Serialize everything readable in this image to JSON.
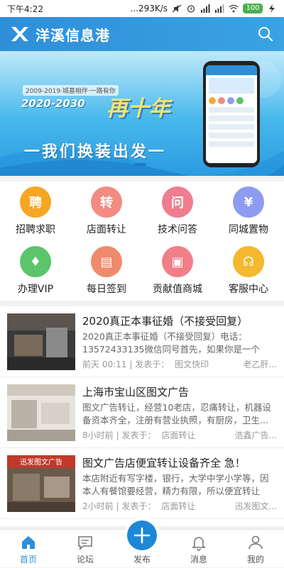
{
  "status": {
    "time": "下午4:22",
    "speed": "...293K/s",
    "battery": "100"
  },
  "header": {
    "title": "洋溪信息港",
    "logo": "X"
  },
  "banner": {
    "tag": "2009-2019·城基相伴·一路有你",
    "year_range": "2020-2030",
    "headline": "再十年",
    "subline": "一我们换装出发一"
  },
  "grid": {
    "items": [
      {
        "label": "招聘求职",
        "glyph": "聘",
        "color": "#f5a623",
        "icon": "recruit-icon"
      },
      {
        "label": "店面转让",
        "glyph": "转",
        "color": "#f28b82",
        "icon": "transfer-icon"
      },
      {
        "label": "技术问答",
        "glyph": "问",
        "color": "#ef7d8f",
        "icon": "qa-icon"
      },
      {
        "label": "同城置物",
        "glyph": "¥",
        "color": "#8d9cf0",
        "icon": "market-icon"
      },
      {
        "label": "办理VIP",
        "glyph": "♦",
        "color": "#5cc46a",
        "icon": "vip-icon"
      },
      {
        "label": "每日签到",
        "glyph": "▤",
        "color": "#f08a6c",
        "icon": "checkin-icon"
      },
      {
        "label": "贡献值商城",
        "glyph": "▣",
        "color": "#f07f8a",
        "icon": "shop-icon"
      },
      {
        "label": "客服中心",
        "glyph": "☊",
        "color": "#f5b82e",
        "icon": "service-icon"
      }
    ]
  },
  "news": [
    {
      "title": "2020真正本事征婚（不接受回复）",
      "desc": "2020真正本事征婚（不接受回复）电话：13572433135微信同号首先，如果你是一个浮...",
      "time": "前天 00:11",
      "posted_in": "发表于：",
      "board": "图文快印",
      "author": "老乙肝..."
    },
    {
      "title": "上海市宝山区图文广告",
      "desc": "图文广告转让，经营10老店，忍痛转让，机器设备资本齐全，注册有营业执照，有厨房，卫生...",
      "time": "8小时前",
      "posted_in": "发表于：",
      "board": "店面转让",
      "author": "浩鑫广告..."
    },
    {
      "title": "图文广告店便宜转让设备齐全 急！",
      "desc": "本店附近有写字楼，银行，大学中学小学等，因本人有餐馆要经营，精力有限，所以便宜转让",
      "time": "2小时前",
      "posted_in": "发表于：",
      "board": "店面转让",
      "author": "迅发图文..."
    }
  ],
  "thumbs": {
    "t3_sign": "迅发图文广告"
  },
  "tabbar": {
    "items": [
      {
        "label": "首页",
        "active": true
      },
      {
        "label": "论坛",
        "active": false
      },
      {
        "label": "发布",
        "active": false
      },
      {
        "label": "消息",
        "active": false
      },
      {
        "label": "我的",
        "active": false
      }
    ]
  },
  "colors": {
    "brand": "#2f8ed8",
    "publish": "#1e88d6"
  }
}
